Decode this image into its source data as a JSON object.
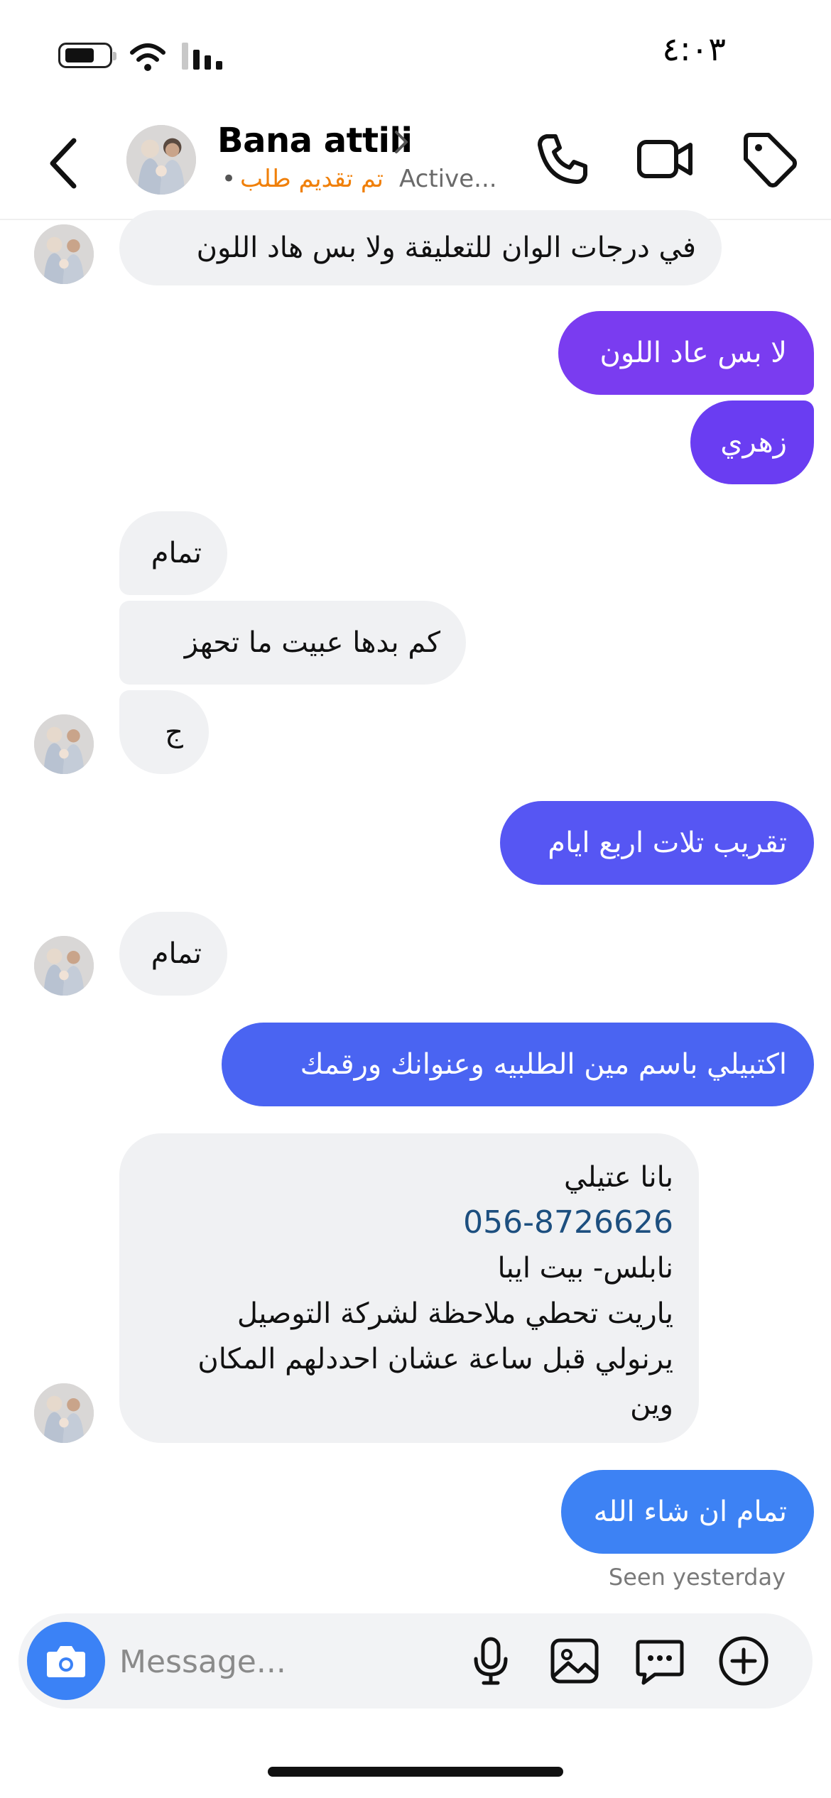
{
  "status_bar": {
    "time": "٤:٠٣"
  },
  "header": {
    "contact_name": "Bana attili",
    "subtitle_dot": "•",
    "subtitle_tag": "تم تقديم طلب",
    "subtitle_status": "Active..."
  },
  "messages": [
    {
      "side": "in",
      "text": "في درجات الوان للتعليقة ولا بس هاد اللون"
    },
    {
      "side": "out",
      "text": "لا بس عاد اللون"
    },
    {
      "side": "out",
      "text": "زهري"
    },
    {
      "side": "in",
      "text": "تمام"
    },
    {
      "side": "in",
      "text": "كم بدها عبيت ما تحهز"
    },
    {
      "side": "in",
      "text": "ج"
    },
    {
      "side": "out",
      "text": "تقريب تلات اربع ايام"
    },
    {
      "side": "in",
      "text": "تمام"
    },
    {
      "side": "out",
      "text": "اكتبيلي باسم مين الطلبيه وعنوانك ورقمك"
    },
    {
      "side": "in",
      "lines": [
        "بانا عتيلي",
        "056-8726626",
        "نابلس- بيت ايبا",
        "ياريت تحطي ملاحظة لشركة التوصيل",
        "يرنولي قبل ساعة عشان احددلهم المكان",
        "وين"
      ]
    },
    {
      "side": "out",
      "text": "تمام ان شاء الله"
    }
  ],
  "seen_label": "Seen yesterday",
  "composer": {
    "placeholder": "Message..."
  },
  "colors": {
    "outgoing_gradient": [
      "#7a3cf0",
      "#6a3df2",
      "#5656f3",
      "#4a64f2",
      "#4470f0",
      "#3d82f4"
    ],
    "incoming_bg": "#f0f1f3",
    "accent": "#3b82f6",
    "tag_orange": "#f0800a",
    "phone_link": "#1d4f7f"
  },
  "icons": [
    "battery-icon",
    "wifi-icon",
    "signal-icon",
    "back-chevron-icon",
    "phone-icon",
    "video-icon",
    "tag-icon",
    "camera-icon",
    "microphone-icon",
    "image-icon",
    "sticker-icon",
    "plus-icon"
  ]
}
